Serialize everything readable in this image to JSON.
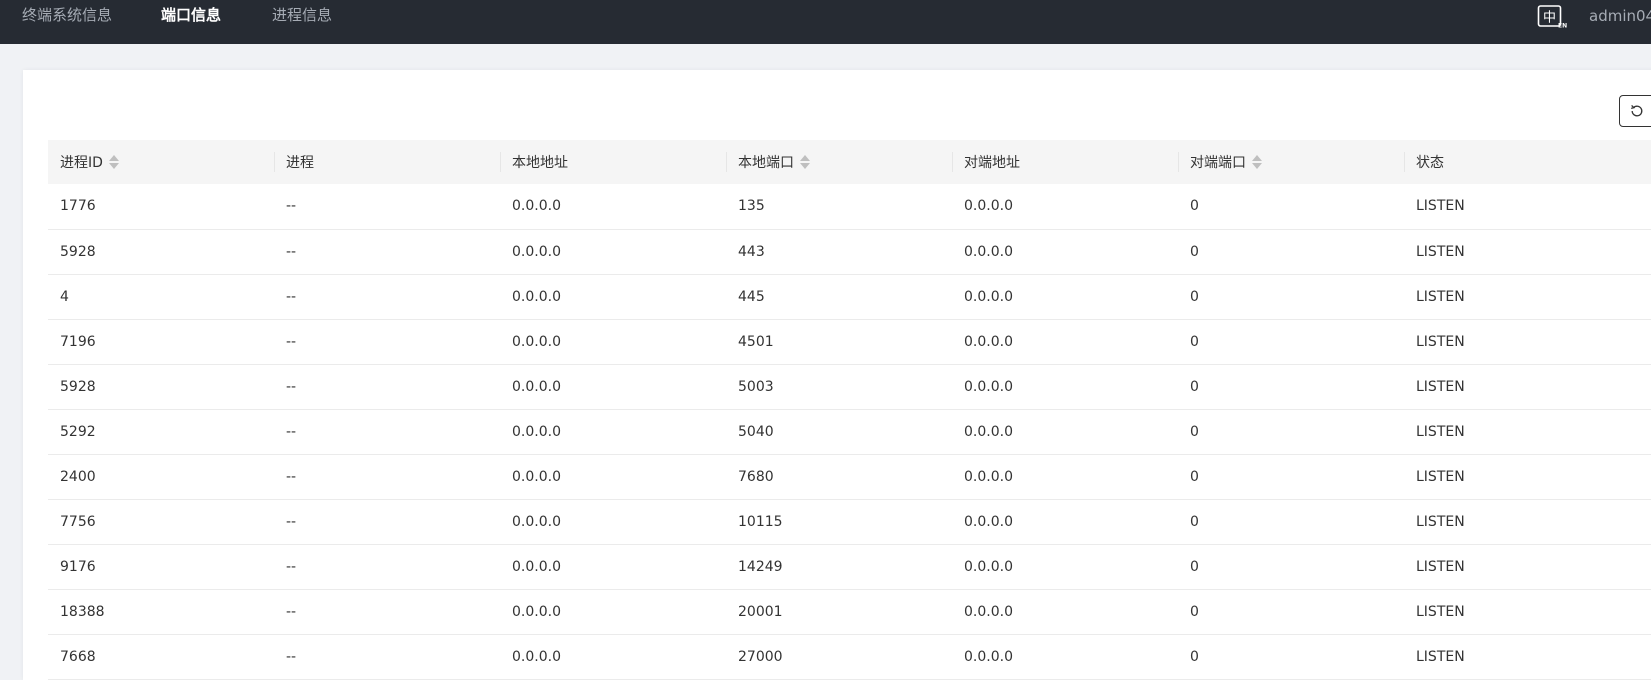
{
  "nav": {
    "items": [
      {
        "label": "终端系统信息",
        "active": false
      },
      {
        "label": "端口信息",
        "active": true
      },
      {
        "label": "进程信息",
        "active": false
      }
    ],
    "lang_icon": "chinese-english-switch-icon",
    "user": "admin04"
  },
  "toolbar": {
    "refresh_icon": "refresh-icon"
  },
  "table": {
    "columns": [
      {
        "label": "进程ID",
        "sortable": true
      },
      {
        "label": "进程",
        "sortable": false
      },
      {
        "label": "本地地址",
        "sortable": false
      },
      {
        "label": "本地端口",
        "sortable": true
      },
      {
        "label": "对端地址",
        "sortable": false
      },
      {
        "label": "对端端口",
        "sortable": true
      },
      {
        "label": "状态",
        "sortable": false
      }
    ],
    "rows": [
      [
        "1776",
        "--",
        "0.0.0.0",
        "135",
        "0.0.0.0",
        "0",
        "LISTEN"
      ],
      [
        "5928",
        "--",
        "0.0.0.0",
        "443",
        "0.0.0.0",
        "0",
        "LISTEN"
      ],
      [
        "4",
        "--",
        "0.0.0.0",
        "445",
        "0.0.0.0",
        "0",
        "LISTEN"
      ],
      [
        "7196",
        "--",
        "0.0.0.0",
        "4501",
        "0.0.0.0",
        "0",
        "LISTEN"
      ],
      [
        "5928",
        "--",
        "0.0.0.0",
        "5003",
        "0.0.0.0",
        "0",
        "LISTEN"
      ],
      [
        "5292",
        "--",
        "0.0.0.0",
        "5040",
        "0.0.0.0",
        "0",
        "LISTEN"
      ],
      [
        "2400",
        "--",
        "0.0.0.0",
        "7680",
        "0.0.0.0",
        "0",
        "LISTEN"
      ],
      [
        "7756",
        "--",
        "0.0.0.0",
        "10115",
        "0.0.0.0",
        "0",
        "LISTEN"
      ],
      [
        "9176",
        "--",
        "0.0.0.0",
        "14249",
        "0.0.0.0",
        "0",
        "LISTEN"
      ],
      [
        "18388",
        "--",
        "0.0.0.0",
        "20001",
        "0.0.0.0",
        "0",
        "LISTEN"
      ],
      [
        "7668",
        "--",
        "0.0.0.0",
        "27000",
        "0.0.0.0",
        "0",
        "LISTEN"
      ]
    ]
  },
  "colors": {
    "topbar": "#262b33",
    "nav_text": "#a6acb5",
    "nav_active": "#ffffff",
    "header_bg": "#f5f5f5"
  }
}
